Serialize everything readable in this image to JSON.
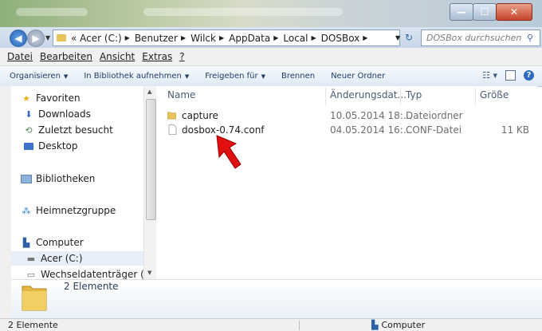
{
  "window": {
    "buttons": {
      "minimize": "—",
      "maximize": "☐",
      "close": "✕"
    }
  },
  "address": {
    "crumbs": [
      "« Acer (C:)",
      "Benutzer",
      "Wilck",
      "AppData",
      "Local",
      "DOSBox"
    ],
    "separator": "▶",
    "search_placeholder": "DOSBox durchsuchen"
  },
  "menu": [
    "Datei",
    "Bearbeiten",
    "Ansicht",
    "Extras",
    "?"
  ],
  "toolbar": {
    "items": [
      "Organisieren",
      "In Bibliothek aufnehmen",
      "Freigeben für",
      "Brennen",
      "Neuer Ordner"
    ]
  },
  "nav": {
    "favorites": "Favoriten",
    "downloads": "Downloads",
    "recent": "Zuletzt besucht",
    "desktop": "Desktop",
    "libraries": "Bibliotheken",
    "homegroup": "Heimnetzgruppe",
    "computer": "Computer",
    "drive_c": "Acer (C:)",
    "drive_j": "Wechseldatenträger (J:)"
  },
  "columns": {
    "name": "Name",
    "date": "Änderungsdat...",
    "type": "Typ",
    "size": "Größe"
  },
  "files": [
    {
      "name": "capture",
      "date": "10.05.2014 18:...",
      "type": "Dateiordner",
      "size": "",
      "icon": "folder-icon"
    },
    {
      "name": "dosbox-0.74.conf",
      "date": "04.05.2014 16:...",
      "type": "CONF-Datei",
      "size": "11 KB",
      "icon": "file-icon"
    }
  ],
  "details": {
    "count": "2 Elemente"
  },
  "status": {
    "left": "2 Elemente",
    "right": "Computer"
  },
  "colors": {
    "accent": "#2d6bbd",
    "annotation_arrow": "#e01010"
  }
}
